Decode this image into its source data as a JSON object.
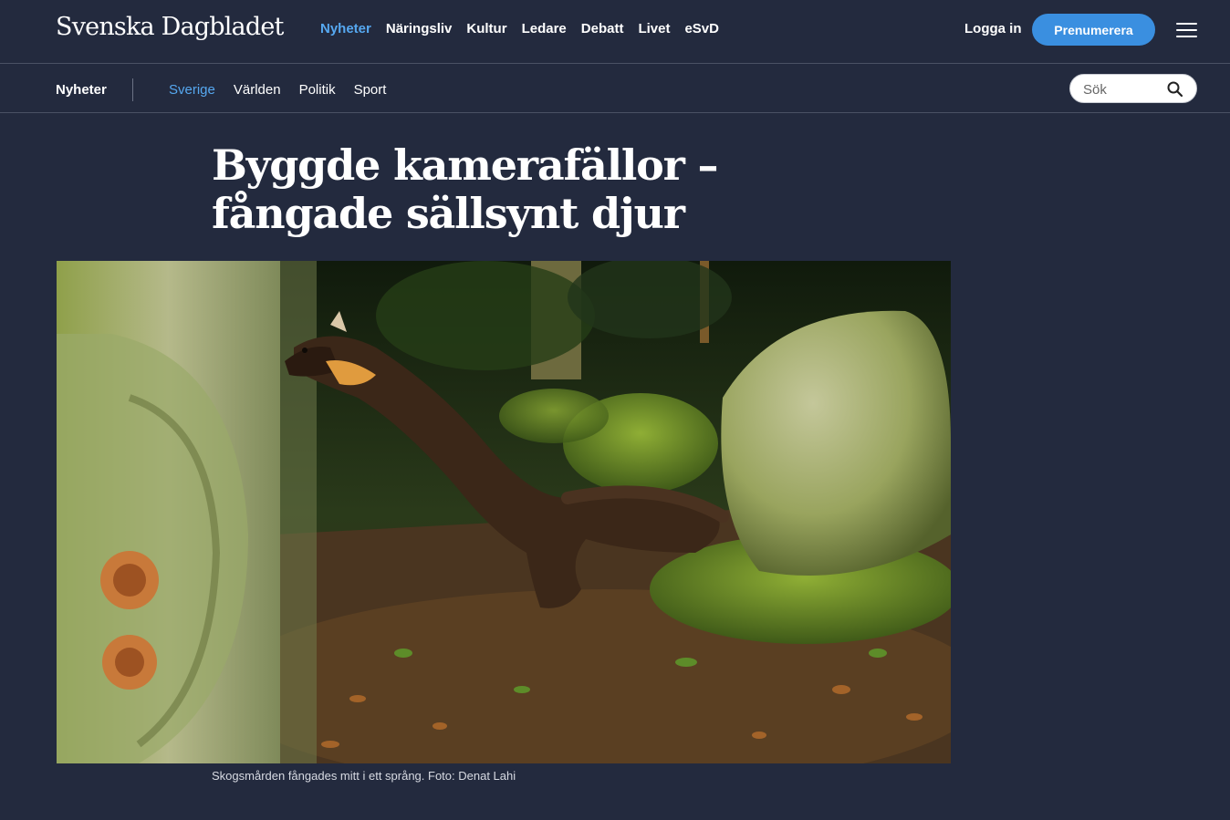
{
  "header": {
    "logo": "Svenska Dagbladet",
    "nav": [
      {
        "label": "Nyheter",
        "active": true
      },
      {
        "label": "Näringsliv",
        "active": false
      },
      {
        "label": "Kultur",
        "active": false
      },
      {
        "label": "Ledare",
        "active": false
      },
      {
        "label": "Debatt",
        "active": false
      },
      {
        "label": "Livet",
        "active": false
      },
      {
        "label": "eSvD",
        "active": false
      }
    ],
    "login_label": "Logga in",
    "subscribe_label": "Prenumerera",
    "menu_icon": "hamburger-menu-icon"
  },
  "subnav": {
    "section": "Nyheter",
    "items": [
      {
        "label": "Sverige",
        "active": true
      },
      {
        "label": "Världen",
        "active": false
      },
      {
        "label": "Politik",
        "active": false
      },
      {
        "label": "Sport",
        "active": false
      }
    ],
    "search_placeholder": "Sök",
    "search_icon": "search-icon"
  },
  "article": {
    "headline": "Byggde kamerafällor – fångade sällsynt djur",
    "image_alt": "Skogsmård som hoppar mot en stenstod i skogen på natten",
    "caption": "Skogsmården fångades mitt i ett språng. Foto: Denat Lahi"
  },
  "colors": {
    "background": "#232a3e",
    "accent": "#56a8f0",
    "button": "#3a8fe0"
  }
}
